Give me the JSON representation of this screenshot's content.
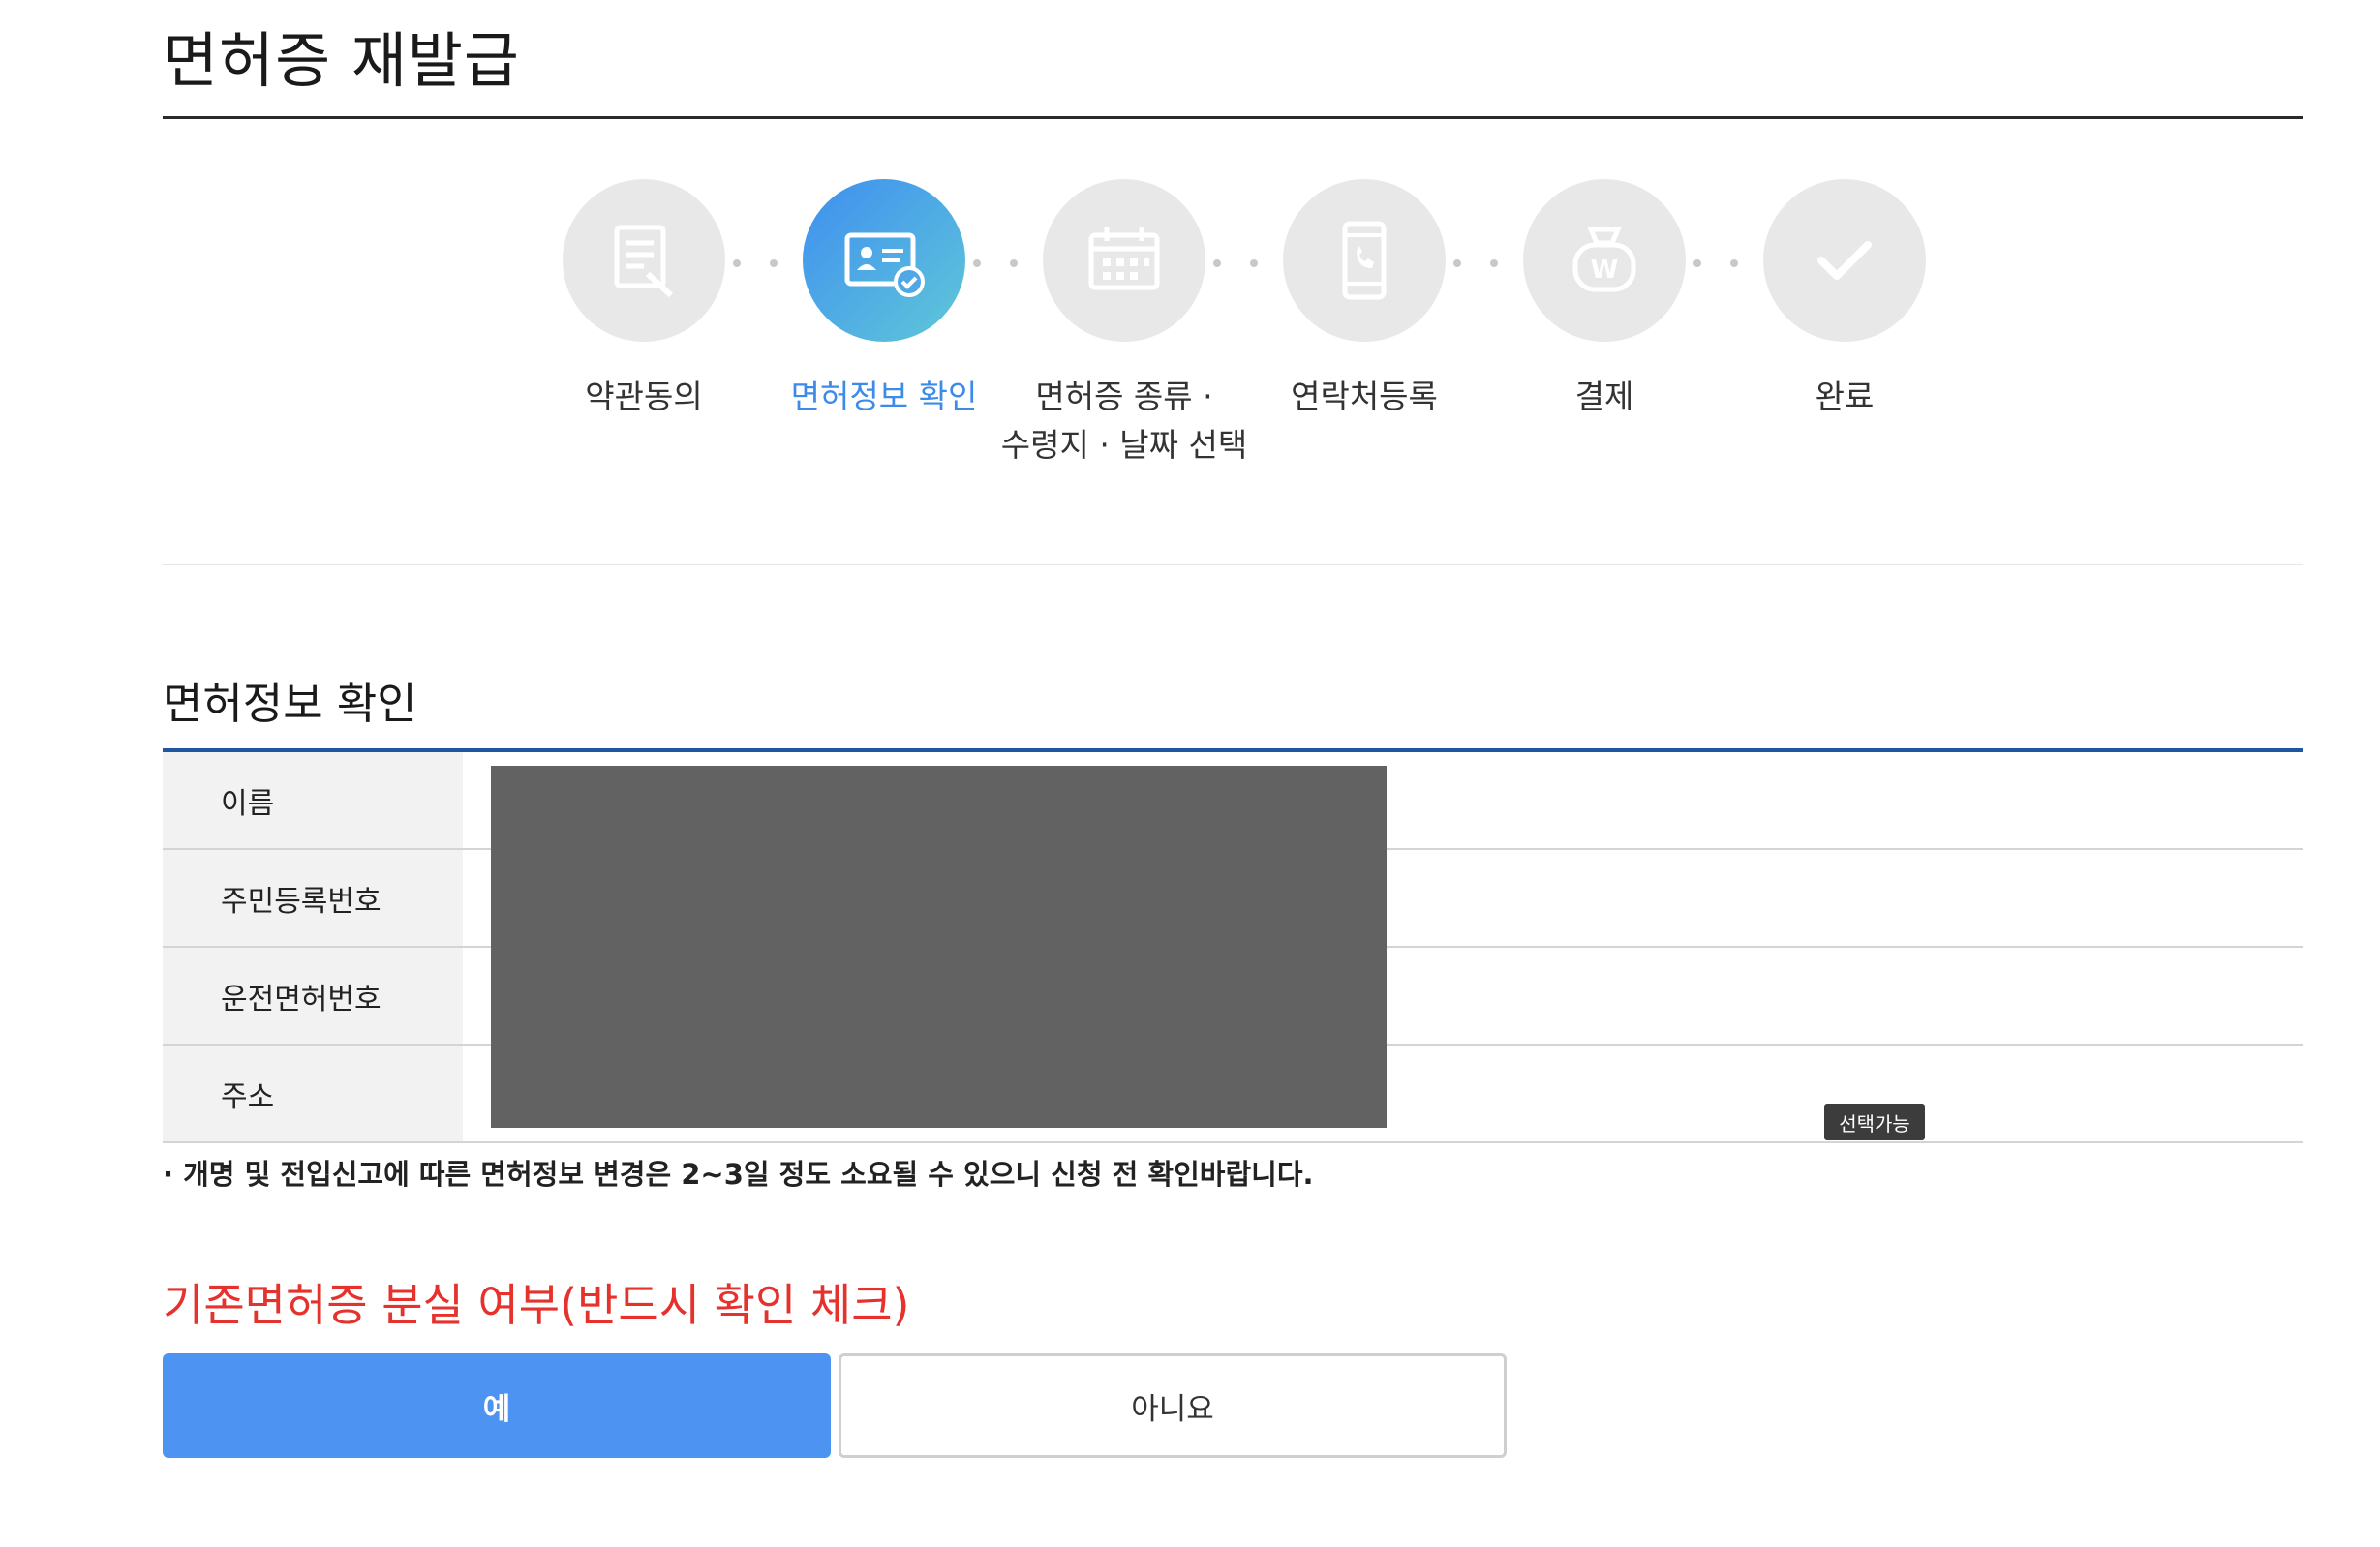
{
  "page": {
    "title": "면허증 재발급"
  },
  "steps": [
    {
      "label": "약관동의",
      "icon": "document-pen-icon",
      "active": false
    },
    {
      "label": "면허정보 확인",
      "icon": "id-card-check-icon",
      "active": true
    },
    {
      "label": "면허증 종류 ·\n수령지 · 날짜 선택",
      "icon": "calendar-icon",
      "active": false
    },
    {
      "label": "연락처등록",
      "icon": "phone-icon",
      "active": false
    },
    {
      "label": "결제",
      "icon": "won-bag-icon",
      "active": false
    },
    {
      "label": "완료",
      "icon": "check-icon",
      "active": false
    }
  ],
  "license_info": {
    "title": "면허정보 확인",
    "rows": [
      {
        "label": "이름"
      },
      {
        "label": "주민등록번호"
      },
      {
        "label": "운전면허번호"
      },
      {
        "label": "주소"
      }
    ],
    "tooltip": "선택가능",
    "notice": "· 개명 및 전입신고에 따른 면허정보 변경은 2~3일 정도 소요될 수 있으니 신청 전 확인바랍니다."
  },
  "loss_check": {
    "title": "기존면허증 분실 여부(반드시 확인 체크)",
    "yes_label": "예",
    "no_label": "아니요"
  },
  "colors": {
    "accent_blue": "#3d8be8",
    "button_blue": "#4d94f2",
    "warning_red": "#e5322d",
    "table_top_border": "#1e56a0"
  }
}
